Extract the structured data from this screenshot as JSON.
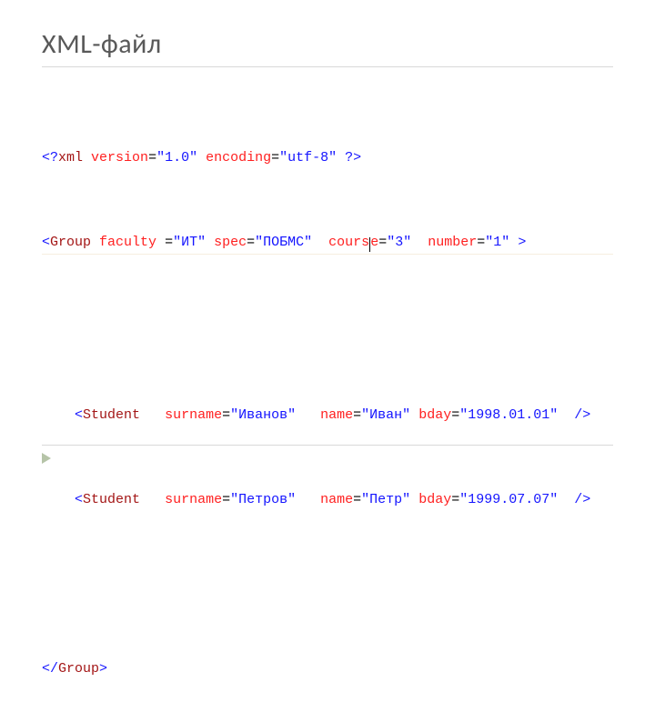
{
  "title": "XML-файл",
  "code": {
    "line1": {
      "open": "<?",
      "tag": "xml",
      "attrs": [
        {
          "name": "version",
          "value": "\"1.0\""
        },
        {
          "name": "encoding",
          "value": "\"utf-8\""
        }
      ],
      "close": "?>"
    },
    "line2": {
      "open": "<",
      "tag": "Group",
      "attrs": [
        {
          "name": "faculty ",
          "eq": "=",
          "value": "\"ИТ\""
        },
        {
          "name": "spec",
          "eq": "=",
          "value": "\"ПОБМС\""
        },
        {
          "name_a": "cours",
          "name_b": "e",
          "eq": "=",
          "value": "\"3\""
        },
        {
          "name": "number",
          "eq": "=",
          "value": "\"1\""
        }
      ],
      "close": ">"
    },
    "line4": {
      "indent": "    ",
      "open": "<",
      "tag": "Student",
      "gap1": "   ",
      "attrs": [
        {
          "name": "surname",
          "value": "\"Иванов\"",
          "after": "   "
        },
        {
          "name": "name",
          "value": "\"Иван\"",
          "after": " "
        },
        {
          "name": "bday",
          "value": "\"1998.01.01\"",
          "after": "  "
        }
      ],
      "close": "/>"
    },
    "line5": {
      "indent": "    ",
      "open": "<",
      "tag": "Student",
      "gap1": "   ",
      "attrs": [
        {
          "name": "surname",
          "value": "\"Петров\"",
          "after": "   "
        },
        {
          "name": "name",
          "value": "\"Петр\"",
          "after": " "
        },
        {
          "name": "bday",
          "value": "\"1999.07.07\"",
          "after": "  "
        }
      ],
      "close": "/>"
    },
    "line7": {
      "open": "</",
      "tag": "Group",
      "close": ">"
    }
  }
}
